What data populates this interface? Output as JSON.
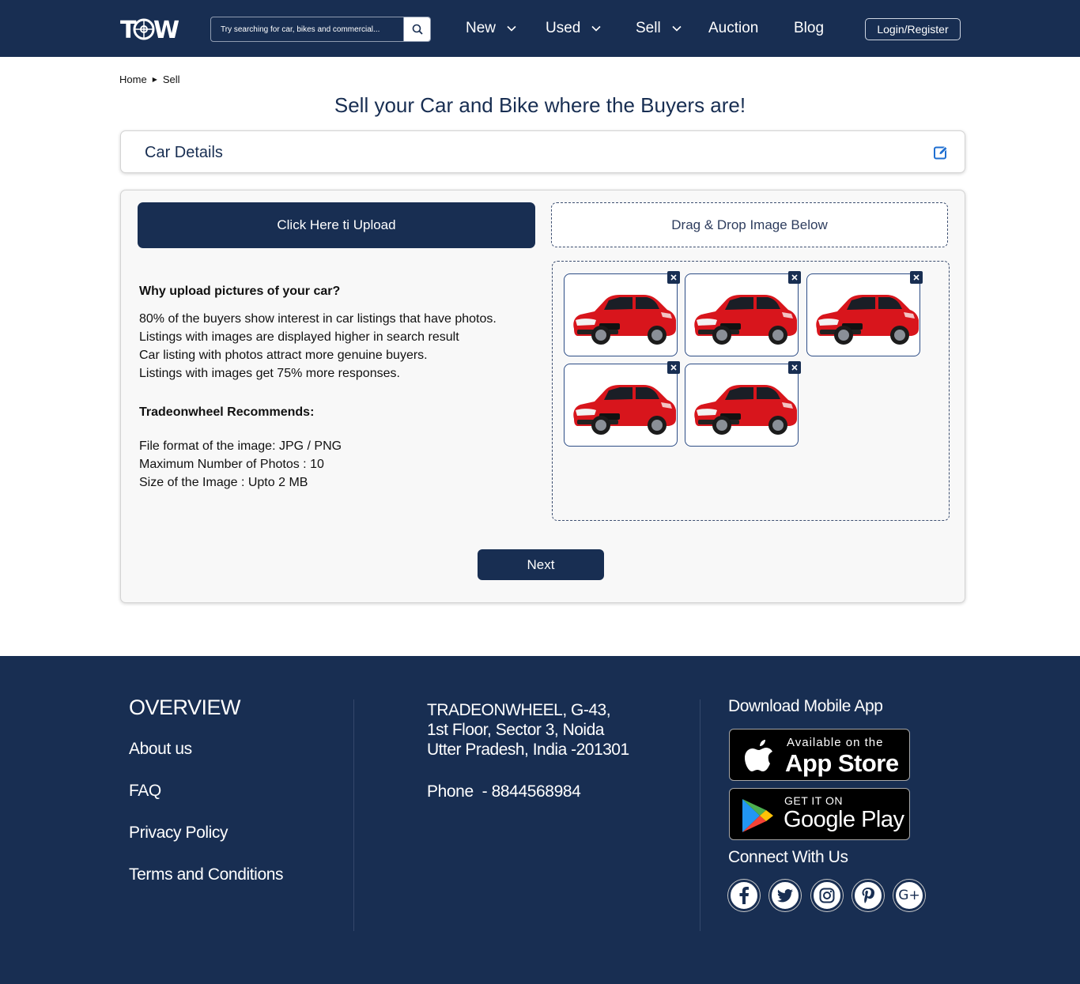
{
  "header": {
    "logo_text": "TOW",
    "search_placeholder": "Try searching for car, bikes and commercial...",
    "nav": [
      {
        "label": "New",
        "has_dropdown": true
      },
      {
        "label": "Used",
        "has_dropdown": true
      },
      {
        "label": "Sell",
        "has_dropdown": true
      },
      {
        "label": "Auction",
        "has_dropdown": false
      },
      {
        "label": "Blog",
        "has_dropdown": false
      }
    ],
    "login_label": "Login/Register"
  },
  "breadcrumb": [
    "Home",
    "Sell"
  ],
  "page_title": "Sell your Car and Bike where the Buyers are!",
  "car_details": {
    "label": "Car Details",
    "icon": "edit-icon"
  },
  "upload": {
    "upload_button": "Click Here ti Upload",
    "dropzone_label": "Drag & Drop Image Below",
    "why_heading": "Why upload pictures of your car?",
    "why_points": [
      "80% of the buyers show interest in car listings that have photos.",
      "Listings with images are displayed higher in search result",
      "Car listing with photos attract more genuine buyers.",
      "Listings with images get 75% more responses."
    ],
    "recommend_heading": "Tradeonwheel Recommends:",
    "recommend_points": [
      "File format of the image: JPG / PNG",
      "Maximum Number of Photos : 10",
      "Size of the Image : Upto 2 MB"
    ],
    "thumbnail_count": 5,
    "next_button": "Next"
  },
  "footer": {
    "overview_heading": "OVERVIEW",
    "links": [
      "About us",
      "FAQ",
      "Privacy Policy",
      "Terms and Conditions"
    ],
    "address": [
      "TRADEONWHEEL, G-43,",
      "1st Floor, Sector 3, Noida",
      "Utter Pradesh, India -201301"
    ],
    "phone": "Phone  - 8844568984",
    "download_heading": "Download Mobile App",
    "app_store": {
      "small": "Available on the",
      "big": "App Store"
    },
    "google_play": {
      "small": "GET IT ON",
      "big": "Google Play"
    },
    "connect_heading": "Connect With Us",
    "social": [
      "facebook-icon",
      "twitter-icon",
      "instagram-icon",
      "pinterest-icon",
      "google-plus-icon"
    ]
  },
  "colors": {
    "primary": "#182e52",
    "car_red": "#d8151c",
    "panel_bg": "#f8f8f8"
  }
}
